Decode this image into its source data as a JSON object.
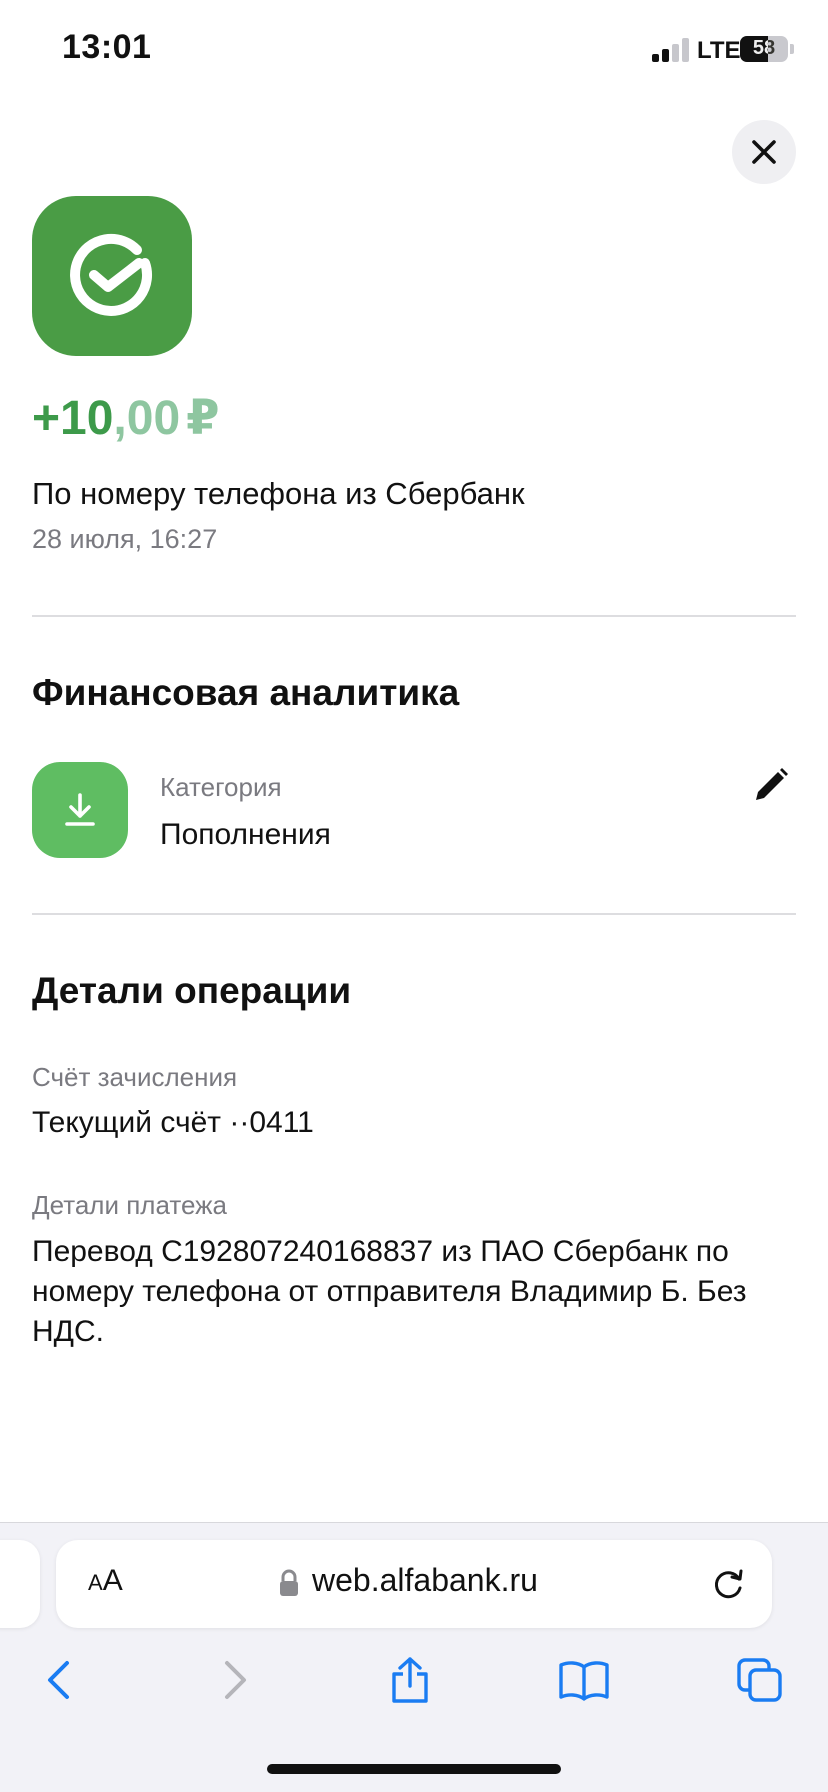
{
  "status_bar": {
    "time": "13:01",
    "network": "LTE",
    "battery_percent": "58",
    "battery_level": 0.58
  },
  "header": {
    "close_icon": "close-icon",
    "bank_logo_icon": "sberbank-logo-icon"
  },
  "transaction": {
    "amount_whole": "+10",
    "amount_fraction": ",00",
    "currency": "₽",
    "description": "По номеру телефона из Сбербанк",
    "date": "28 июля, 16:27"
  },
  "analytics": {
    "title": "Финансовая аналитика",
    "category_label": "Категория",
    "category_value": "Пополнения",
    "category_icon": "download-icon",
    "edit_icon": "pencil-icon"
  },
  "details": {
    "title": "Детали операции",
    "account_label": "Счёт зачисления",
    "account_value": "Текущий счёт ··0411",
    "payment_label": "Детали платежа",
    "payment_value": "Перевод C192807240168837 из ПАО Сбербанк по номеру телефона от отправителя Владимир Б. Без НДС."
  },
  "browser": {
    "text_size_label_small": "A",
    "text_size_label_large": "A",
    "url": "web.alfabank.ru",
    "toolbar_icons": [
      "back-icon",
      "forward-icon",
      "share-icon",
      "bookmarks-icon",
      "tabs-icon"
    ]
  },
  "colors": {
    "amount_green": "#3d9a4a",
    "amount_green_light": "#8ec6a0",
    "sber_green": "#4a9c45",
    "category_green": "#5fbd62",
    "safari_blue": "#1a7cf2",
    "secondary_text": "#7a7a80"
  }
}
